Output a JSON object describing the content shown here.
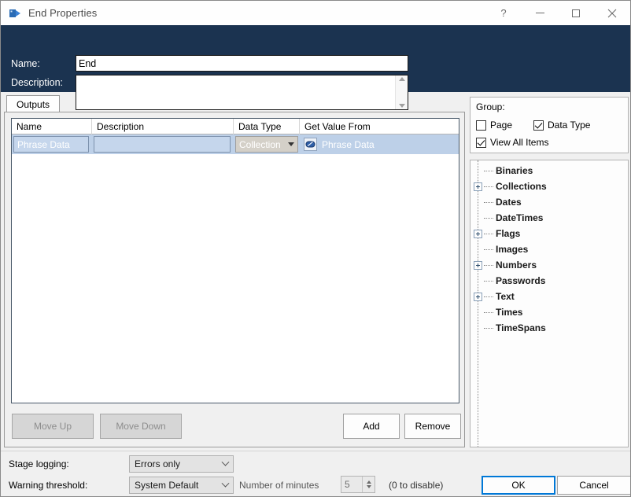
{
  "window": {
    "title": "End Properties",
    "icon": "end-stage-icon",
    "controls": {
      "help": "?",
      "minimize": "minimize-icon",
      "maximize": "maximize-icon",
      "close": "close-icon"
    }
  },
  "header": {
    "name_label": "Name:",
    "name_value": "End",
    "description_label": "Description:",
    "description_value": "",
    "description_placeholder": ""
  },
  "tabs": [
    {
      "label": "Outputs",
      "selected": true
    }
  ],
  "grid": {
    "columns": [
      "Name",
      "Description",
      "Data Type",
      "Get Value From"
    ],
    "rows": [
      {
        "name": "Phrase Data",
        "description": "",
        "data_type": "Collection",
        "get_value_from": "Phrase Data",
        "value_icon": "collection-data-item-icon",
        "selected": true
      }
    ]
  },
  "grid_buttons": {
    "move_up": "Move Up",
    "move_down": "Move Down",
    "add": "Add",
    "remove": "Remove"
  },
  "group_panel": {
    "title": "Group:",
    "checkboxes": [
      {
        "label": "Page",
        "checked": false
      },
      {
        "label": "Data Type",
        "checked": true
      },
      {
        "label": "View All Items",
        "checked": true
      }
    ]
  },
  "tree": {
    "nodes": [
      {
        "label": "Binaries",
        "expandable": false
      },
      {
        "label": "Collections",
        "expandable": true
      },
      {
        "label": "Dates",
        "expandable": false
      },
      {
        "label": "DateTimes",
        "expandable": false
      },
      {
        "label": "Flags",
        "expandable": true
      },
      {
        "label": "Images",
        "expandable": false
      },
      {
        "label": "Numbers",
        "expandable": true
      },
      {
        "label": "Passwords",
        "expandable": false
      },
      {
        "label": "Text",
        "expandable": true
      },
      {
        "label": "Times",
        "expandable": false
      },
      {
        "label": "TimeSpans",
        "expandable": false
      }
    ]
  },
  "bottom": {
    "stage_logging_label": "Stage logging:",
    "stage_logging_value": "Errors only",
    "warning_threshold_label": "Warning threshold:",
    "warning_threshold_value": "System Default",
    "minutes_label": "Number of minutes",
    "minutes_value": "5",
    "disable_hint": "(0 to disable)",
    "ok": "OK",
    "cancel": "Cancel"
  },
  "colors": {
    "header_navy": "#1b3350",
    "selection_blue": "#bdd0e8",
    "focus_blue": "#0078d7"
  }
}
